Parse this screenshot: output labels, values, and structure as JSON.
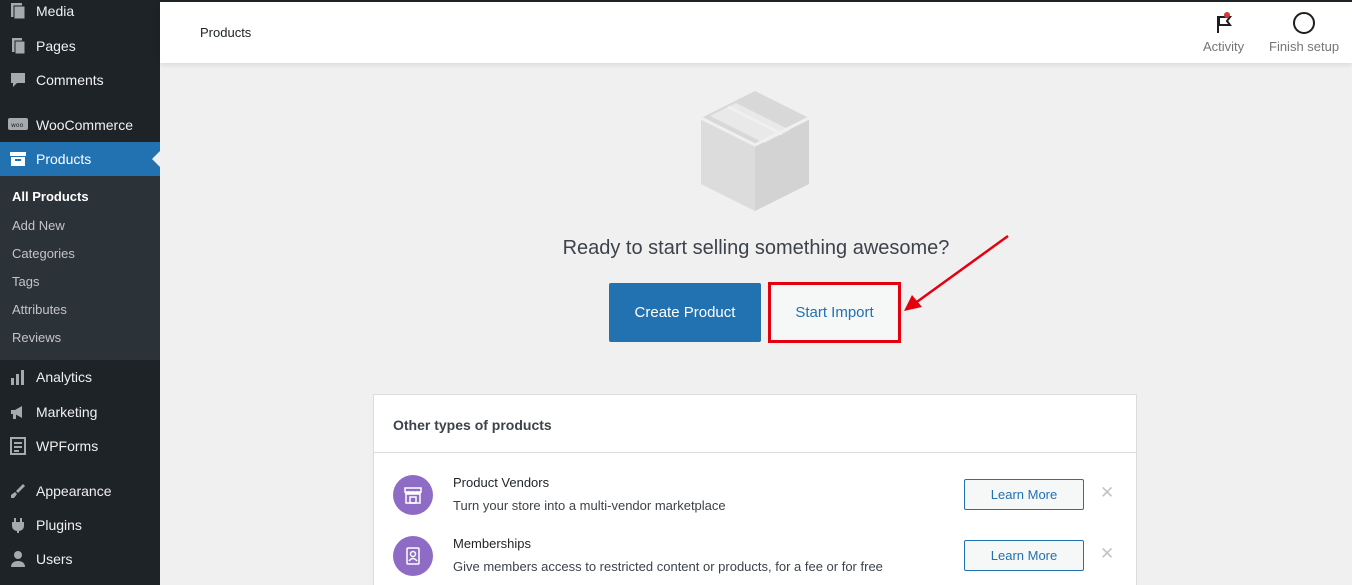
{
  "sidebar": {
    "items": [
      {
        "label": "Media",
        "icon": "media-icon"
      },
      {
        "label": "Pages",
        "icon": "pages-icon"
      },
      {
        "label": "Comments",
        "icon": "comments-icon"
      },
      {
        "label": "WooCommerce",
        "icon": "woocommerce-icon"
      },
      {
        "label": "Products",
        "icon": "products-icon",
        "active": true
      },
      {
        "label": "Analytics",
        "icon": "analytics-icon"
      },
      {
        "label": "Marketing",
        "icon": "marketing-icon"
      },
      {
        "label": "WPForms",
        "icon": "wpforms-icon"
      },
      {
        "label": "Appearance",
        "icon": "appearance-icon"
      },
      {
        "label": "Plugins",
        "icon": "plugins-icon"
      },
      {
        "label": "Users",
        "icon": "users-icon"
      }
    ],
    "submenu": [
      "All Products",
      "Add New",
      "Categories",
      "Tags",
      "Attributes",
      "Reviews"
    ]
  },
  "header": {
    "title": "Products",
    "activity_label": "Activity",
    "finish_setup_label": "Finish setup"
  },
  "main": {
    "headline": "Ready to start selling something awesome?",
    "create_product_label": "Create Product",
    "start_import_label": "Start Import"
  },
  "panel": {
    "title": "Other types of products",
    "rows": [
      {
        "title": "Product Vendors",
        "description": "Turn your store into a multi-vendor marketplace",
        "button": "Learn More",
        "icon": "storefront-icon"
      },
      {
        "title": "Memberships",
        "description": "Give members access to restricted content or products, for a fee or for free",
        "button": "Learn More",
        "icon": "member-badge-icon"
      }
    ]
  },
  "colors": {
    "accent": "#2271b1",
    "sidebar_bg": "#1d2327",
    "highlight": "#e4000f",
    "extension_icon_bg": "#8e6bc5"
  }
}
